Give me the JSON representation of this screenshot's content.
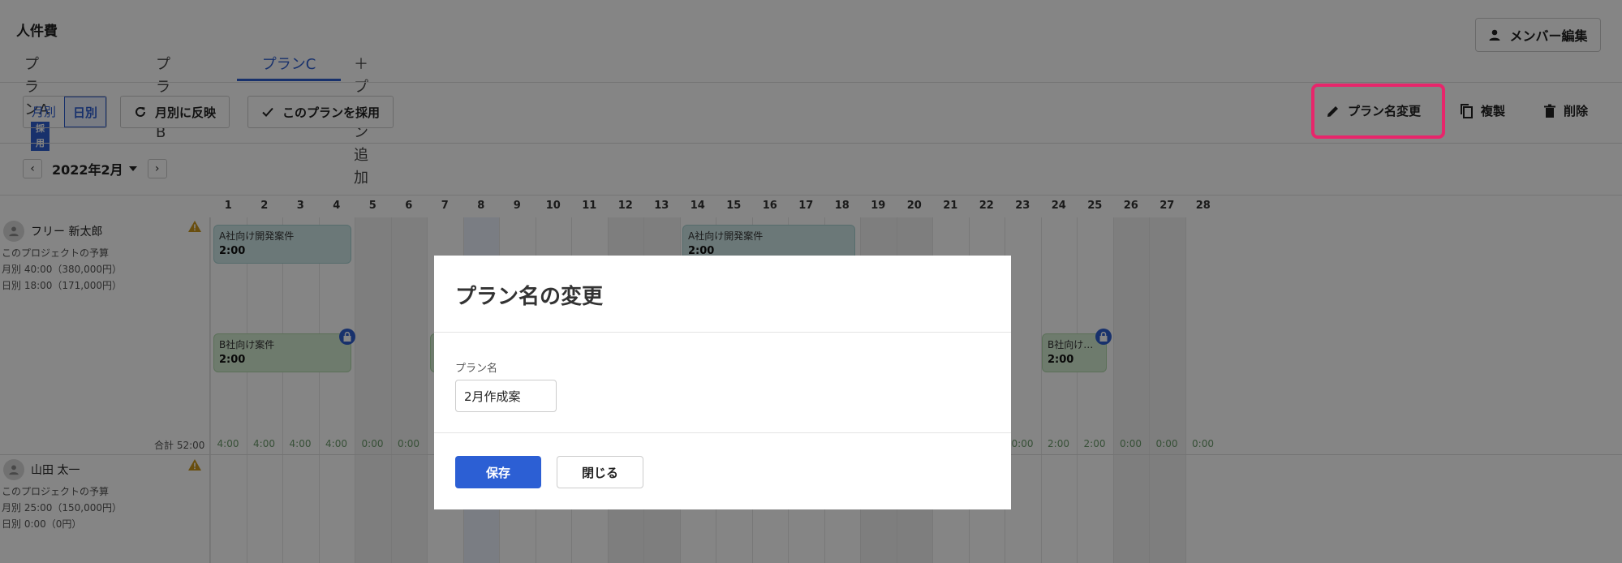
{
  "app": {
    "title": "人件費"
  },
  "header": {
    "member_edit_label": "メンバー編集",
    "member_edit_icon": "person-icon"
  },
  "tabs": [
    {
      "label": "プランA",
      "badge": "採用"
    },
    {
      "label": "プランB"
    },
    {
      "label": "プランC",
      "active": true
    },
    {
      "label": "＋プラン追加"
    }
  ],
  "toolbar": {
    "view_monthly": "月別",
    "view_daily": "日別",
    "reflect_label": "月別に反映",
    "adopt_label": "このプランを採用",
    "rename_label": "プラン名変更",
    "duplicate_label": "複製",
    "delete_label": "削除"
  },
  "month_nav": {
    "prev": "‹",
    "next": "›",
    "label": "2022年2月"
  },
  "calendar": {
    "days": [
      "1",
      "2",
      "3",
      "4",
      "5",
      "6",
      "7",
      "8",
      "9",
      "10",
      "11",
      "12",
      "13",
      "14",
      "15",
      "16",
      "17",
      "18",
      "19",
      "20",
      "21",
      "22",
      "23",
      "24",
      "25",
      "26",
      "27",
      "28"
    ],
    "people": [
      {
        "name": "フリー 新太郎",
        "budget_heading": "このプロジェクトの予算",
        "budget_monthly": "月別 40:00（380,000円）",
        "budget_daily": "日別 18:00（171,000円）",
        "tasks": [
          {
            "title": "A社向け開発案件",
            "hours": "2:00"
          },
          {
            "title": "A社向け開発案件",
            "hours": "2:00"
          },
          {
            "title": "B社向け案件",
            "hours": "2:00"
          },
          {
            "title": "B社向け…",
            "hours": "2:00"
          }
        ],
        "total_label": "合計 52:00",
        "totals_left": [
          "4:00",
          "4:00",
          "4:00",
          "4:00",
          "0:00",
          "0:00"
        ],
        "totals_right": [
          "0:00",
          "2:00",
          "2:00",
          "0:00",
          "0:00",
          "0:00"
        ]
      },
      {
        "name": "山田 太一",
        "budget_heading": "このプロジェクトの予算",
        "budget_monthly": "月別 25:00（150,000円）",
        "budget_daily": "日別 0:00（0円）"
      }
    ]
  },
  "modal": {
    "title": "プラン名の変更",
    "field_label": "プラン名",
    "field_value": "2月作成案",
    "save_label": "保存",
    "close_label": "閉じる"
  }
}
